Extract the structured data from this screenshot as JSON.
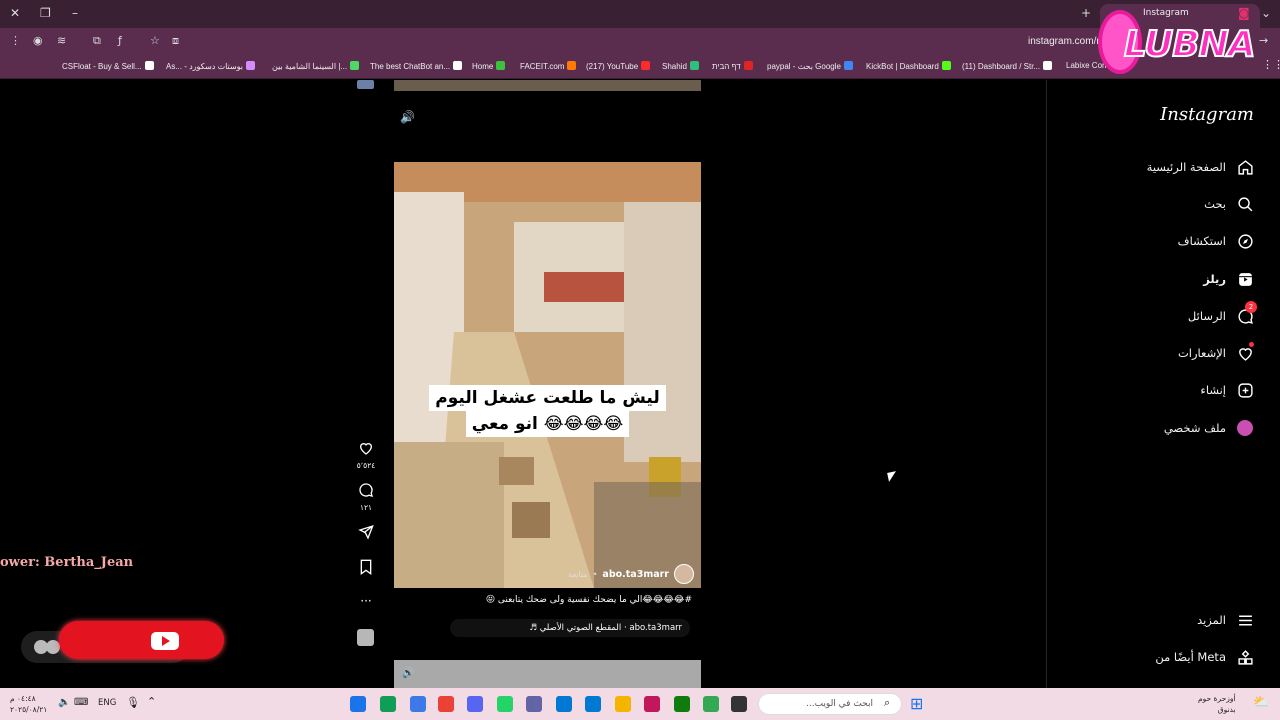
{
  "browser": {
    "tab_title": "Instagram",
    "url": "instagram.com/r",
    "bookmarks": [
      "CSFloat - Buy & Sell...",
      "As... - بوستات دسكورد",
      "السينما الشامية بين |...",
      "The best ChatBot an...",
      "Home",
      "FACEIT.com",
      "(217) YouTube",
      "Shahid",
      "דף הבית",
      "paypal - بحث Google",
      "KickBot | Dashboard",
      "(11) Dashboard / Str...",
      "Labixe Con"
    ],
    "bookmark_colors": [
      "#ffffff",
      "#d68bff",
      "#4cd964",
      "#ffffff",
      "#3fbf3f",
      "#ff7a00",
      "#ff2a2a",
      "#2ebf7a",
      "#e02424",
      "#4285f4",
      "#53fc18",
      "#ffffff",
      "#6ac46a"
    ]
  },
  "overlay": {
    "logo_text": "LUBNA",
    "follower_text": "ower: Bertha_Jean"
  },
  "sidebar": {
    "logo": "Instagram",
    "items": [
      {
        "label": "الصفحة الرئيسية",
        "icon": "home-icon"
      },
      {
        "label": "بحث",
        "icon": "search-icon"
      },
      {
        "label": "استكشاف",
        "icon": "explore-icon"
      },
      {
        "label": "ريلز",
        "icon": "reels-icon"
      },
      {
        "label": "الرسائل",
        "icon": "messenger-icon",
        "badge": "2"
      },
      {
        "label": "الإشعارات",
        "icon": "heart-icon"
      },
      {
        "label": "إنشاء",
        "icon": "plus-square-icon"
      },
      {
        "label": "ملف شخصي",
        "icon": "avatar-icon"
      }
    ],
    "more_label": "المزيد",
    "meta_label": "أيضًا من Meta"
  },
  "reel": {
    "caption_line1": "ليش ما طلعت عشغل اليوم",
    "caption_line2": "انو معي 😂😂😂😂",
    "author": "abo.ta3marr",
    "follow_label": "متابعة",
    "description": "#😂😂😂😂الي ما يضحك نفسية ولى ضحك يتابعنى 😝",
    "audio": "abo.ta3marr · المقطع الصوتي الأصلي ♬",
    "likes": "٥٬٥٢٤",
    "comments": "١٢١"
  },
  "taskbar": {
    "search_placeholder": "ابحث في الويب...",
    "language": "ENG",
    "clock_time": "٠٤:٤٨ م",
    "clock_date": "٢٠٢٥/٠٨/٢١",
    "weather_line1": "أوزحرة حوم",
    "weather_line2": "بدنوق",
    "app_colors": [
      "#1a73e8",
      "#0f9d58",
      "#3d7ae8",
      "#ea4335",
      "#5865f2",
      "#25d366",
      "#6264a7",
      "#0078d4",
      "#0078d4",
      "#f4b400",
      "#c2185b",
      "#107c10",
      "#34a853",
      "#333333"
    ]
  }
}
